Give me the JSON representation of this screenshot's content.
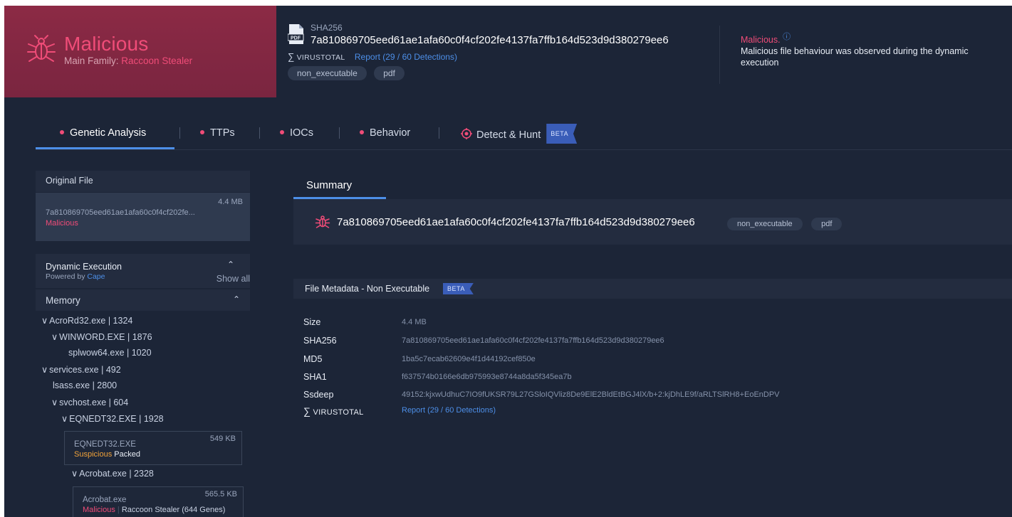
{
  "header": {
    "verdict": "Malicious",
    "main_family_label": "Main Family:",
    "main_family": "Raccoon Stealer",
    "sha_label": "SHA256",
    "sha_value": "7a810869705eed61ae1afa60c0f4cf202fe4137fa7ffb164d523d9d380279ee6",
    "vt_logo": "VIRUSTOTAL",
    "vt_report": "Report (29 / 60 Detections)",
    "tags": [
      "non_executable",
      "pdf"
    ],
    "note_status": "Malicious.",
    "note_desc": "Malicious file behaviour was observed during the dynamic execution"
  },
  "tabs": {
    "genetic": "Genetic Analysis",
    "ttps": "TTPs",
    "iocs": "IOCs",
    "behavior": "Behavior",
    "detect": "Detect & Hunt",
    "beta": "BETA"
  },
  "left": {
    "original_file_title": "Original File",
    "original_size": "4.4 MB",
    "original_hash": "7a810869705eed61ae1afa60c0f4cf202fe...",
    "original_verdict": "Malicious",
    "dynamic_title": "Dynamic Execution",
    "dynamic_powered": "Powered by",
    "dynamic_cape": "Cape",
    "show_all": "Show all",
    "memory_title": "Memory",
    "processes": [
      "AcroRd32.exe | 1324",
      "WINWORD.EXE | 1876",
      "splwow64.exe | 1020",
      "services.exe | 492",
      "lsass.exe | 2800",
      "svchost.exe | 604",
      "EQNEDT32.EXE | 1928",
      "Acrobat.exe | 2328"
    ],
    "card1": {
      "name": "EQNEDT32.EXE",
      "size": "549 KB",
      "verdict": "Suspicious",
      "extra": "Packed"
    },
    "card2": {
      "name": "Acrobat.exe",
      "size": "565.5 KB",
      "verdict": "Malicious",
      "sep": "|",
      "family": "Raccoon Stealer (644 Genes)"
    }
  },
  "main": {
    "summary_tab": "Summary",
    "summary_hash": "7a810869705eed61ae1afa60c0f4cf202fe4137fa7ffb164d523d9d380279ee6",
    "summary_tags": [
      "non_executable",
      "pdf"
    ],
    "meta_title": "File Metadata - Non Executable",
    "meta_beta": "BETA",
    "metadata": [
      {
        "key": "Size",
        "value": "4.4 MB"
      },
      {
        "key": "SHA256",
        "value": "7a810869705eed61ae1afa60c0f4cf202fe4137fa7ffb164d523d9d380279ee6"
      },
      {
        "key": "MD5",
        "value": "1ba5c7ecab62609e4f1d44192cef850e"
      },
      {
        "key": "SHA1",
        "value": "f637574b0166e6db975993e8744a8da5f345ea7b"
      },
      {
        "key": "Ssdeep",
        "value": "49152:kjxwUdhuC7IO9fUKSR79L27GSloIQVliz8De9ElE2BldEtBGJ4lX/b+2:kjDhLE9f/aRLTSlRH8+EoEnDPV"
      }
    ],
    "vt_label": "VIRUSTOTAL",
    "vt_report": "Report (29 / 60 Detections)"
  },
  "colors": {
    "accent_red": "#f04c78",
    "link_blue": "#4d8fe8",
    "bg": "#1c2537",
    "banner": "#8c2a45"
  }
}
